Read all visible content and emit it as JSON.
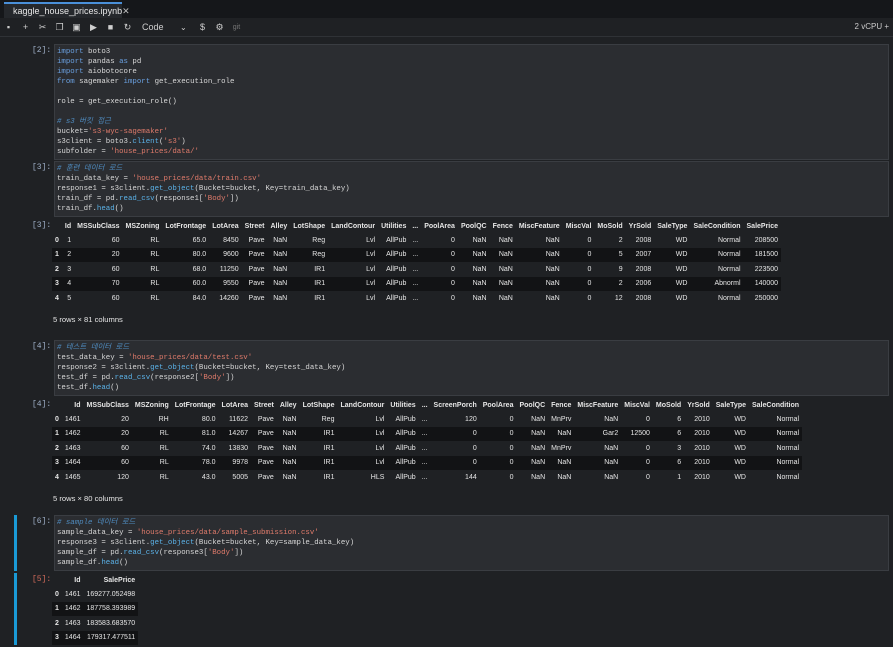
{
  "tab": {
    "title": "kaggle_house_prices.ipynb"
  },
  "toolbar": {
    "cell_type": "Code",
    "git": "git",
    "kernel": "2 vCPU +"
  },
  "colors": {
    "accent": "#1a9ad6",
    "background": "#1f2124"
  },
  "cells": [
    {
      "prompt": "[2]:",
      "lines": [
        "import boto3",
        "import pandas as pd",
        "import aiobotocore",
        "from sagemaker import get_execution_role",
        "",
        "role = get_execution_role()",
        "",
        "# s3 버킷 접근",
        "bucket='s3-wyc-sagemaker'",
        "s3client = boto3.client('s3')",
        "subfolder = 'house_prices/data/'"
      ]
    },
    {
      "prompt": "[3]:",
      "lines": [
        "# 훈련 데이터 로드",
        "train_data_key = 'house_prices/data/train.csv'",
        "response1 = s3client.get_object(Bucket=bucket, Key=train_data_key)",
        "train_df = pd.read_csv(response1['Body'])",
        "train_df.head()"
      ]
    },
    {
      "prompt": "[4]:",
      "lines": [
        "# 테스트 데이터 로드",
        "test_data_key = 'house_prices/data/test.csv'",
        "response2 = s3client.get_object(Bucket=bucket, Key=test_data_key)",
        "test_df = pd.read_csv(response2['Body'])",
        "test_df.head()"
      ]
    },
    {
      "prompt": "[6]:",
      "lines": [
        "# sample 데이터 로드",
        "sample_data_key = 'house_prices/data/sample_submission.csv'",
        "response3 = s3client.get_object(Bucket=bucket, Key=sample_data_key)",
        "sample_df = pd.read_csv(response3['Body'])",
        "sample_df.head()"
      ]
    }
  ],
  "outputs": {
    "train": {
      "prompt": "[3]:",
      "columns": [
        "",
        "Id",
        "MSSubClass",
        "MSZoning",
        "LotFrontage",
        "LotArea",
        "Street",
        "Alley",
        "LotShape",
        "LandContour",
        "Utilities",
        "...",
        "PoolArea",
        "PoolQC",
        "Fence",
        "MiscFeature",
        "MiscVal",
        "MoSold",
        "YrSold",
        "SaleType",
        "SaleCondition",
        "SalePrice"
      ],
      "rows": [
        [
          "0",
          "1",
          "60",
          "RL",
          "65.0",
          "8450",
          "Pave",
          "NaN",
          "Reg",
          "Lvl",
          "AllPub",
          "...",
          "0",
          "NaN",
          "NaN",
          "NaN",
          "0",
          "2",
          "2008",
          "WD",
          "Normal",
          "208500"
        ],
        [
          "1",
          "2",
          "20",
          "RL",
          "80.0",
          "9600",
          "Pave",
          "NaN",
          "Reg",
          "Lvl",
          "AllPub",
          "...",
          "0",
          "NaN",
          "NaN",
          "NaN",
          "0",
          "5",
          "2007",
          "WD",
          "Normal",
          "181500"
        ],
        [
          "2",
          "3",
          "60",
          "RL",
          "68.0",
          "11250",
          "Pave",
          "NaN",
          "IR1",
          "Lvl",
          "AllPub",
          "...",
          "0",
          "NaN",
          "NaN",
          "NaN",
          "0",
          "9",
          "2008",
          "WD",
          "Normal",
          "223500"
        ],
        [
          "3",
          "4",
          "70",
          "RL",
          "60.0",
          "9550",
          "Pave",
          "NaN",
          "IR1",
          "Lvl",
          "AllPub",
          "...",
          "0",
          "NaN",
          "NaN",
          "NaN",
          "0",
          "2",
          "2006",
          "WD",
          "Abnorml",
          "140000"
        ],
        [
          "4",
          "5",
          "60",
          "RL",
          "84.0",
          "14260",
          "Pave",
          "NaN",
          "IR1",
          "Lvl",
          "AllPub",
          "...",
          "0",
          "NaN",
          "NaN",
          "NaN",
          "0",
          "12",
          "2008",
          "WD",
          "Normal",
          "250000"
        ]
      ],
      "summary": "5 rows × 81 columns"
    },
    "test": {
      "prompt": "[4]:",
      "columns": [
        "",
        "Id",
        "MSSubClass",
        "MSZoning",
        "LotFrontage",
        "LotArea",
        "Street",
        "Alley",
        "LotShape",
        "LandContour",
        "Utilities",
        "...",
        "ScreenPorch",
        "PoolArea",
        "PoolQC",
        "Fence",
        "MiscFeature",
        "MiscVal",
        "MoSold",
        "YrSold",
        "SaleType",
        "SaleCondition"
      ],
      "rows": [
        [
          "0",
          "1461",
          "20",
          "RH",
          "80.0",
          "11622",
          "Pave",
          "NaN",
          "Reg",
          "Lvl",
          "AllPub",
          "...",
          "120",
          "0",
          "NaN",
          "MnPrv",
          "NaN",
          "0",
          "6",
          "2010",
          "WD",
          "Normal"
        ],
        [
          "1",
          "1462",
          "20",
          "RL",
          "81.0",
          "14267",
          "Pave",
          "NaN",
          "IR1",
          "Lvl",
          "AllPub",
          "...",
          "0",
          "0",
          "NaN",
          "NaN",
          "Gar2",
          "12500",
          "6",
          "2010",
          "WD",
          "Normal"
        ],
        [
          "2",
          "1463",
          "60",
          "RL",
          "74.0",
          "13830",
          "Pave",
          "NaN",
          "IR1",
          "Lvl",
          "AllPub",
          "...",
          "0",
          "0",
          "NaN",
          "MnPrv",
          "NaN",
          "0",
          "3",
          "2010",
          "WD",
          "Normal"
        ],
        [
          "3",
          "1464",
          "60",
          "RL",
          "78.0",
          "9978",
          "Pave",
          "NaN",
          "IR1",
          "Lvl",
          "AllPub",
          "...",
          "0",
          "0",
          "NaN",
          "NaN",
          "NaN",
          "0",
          "6",
          "2010",
          "WD",
          "Normal"
        ],
        [
          "4",
          "1465",
          "120",
          "RL",
          "43.0",
          "5005",
          "Pave",
          "NaN",
          "IR1",
          "HLS",
          "AllPub",
          "...",
          "144",
          "0",
          "NaN",
          "NaN",
          "NaN",
          "0",
          "1",
          "2010",
          "WD",
          "Normal"
        ]
      ],
      "summary": "5 rows × 80 columns"
    },
    "sample": {
      "prompt": "[5]:",
      "columns": [
        "",
        "Id",
        "SalePrice"
      ],
      "rows": [
        [
          "0",
          "1461",
          "169277.052498"
        ],
        [
          "1",
          "1462",
          "187758.393989"
        ],
        [
          "2",
          "1463",
          "183583.683570"
        ],
        [
          "3",
          "1464",
          "179317.477511"
        ]
      ]
    }
  }
}
